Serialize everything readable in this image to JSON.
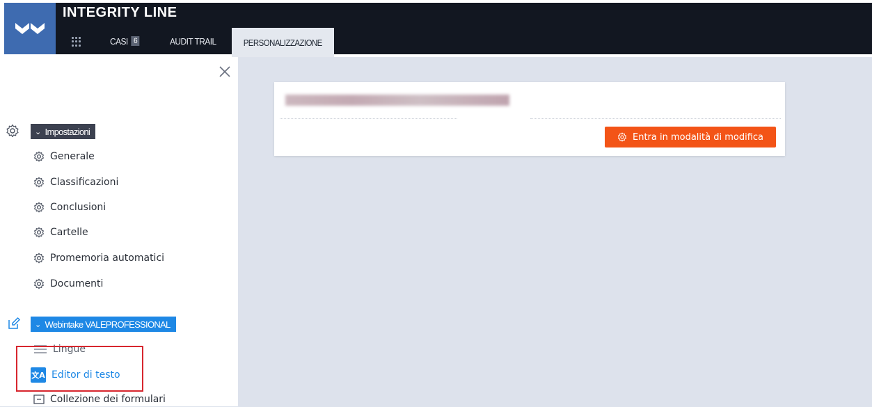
{
  "app": {
    "title": "INTEGRITY LINE"
  },
  "nav": {
    "tabs": [
      {
        "label": "CASI",
        "badge": "6"
      },
      {
        "label": "AUDIT TRAIL"
      },
      {
        "label": "PERSONALIZZAZIONE",
        "active": true
      }
    ]
  },
  "sidebar": {
    "settings_section": {
      "label": "Impostazioni",
      "items": [
        "Generale",
        "Classificazioni",
        "Conclusioni",
        "Cartelle",
        "Promemoria automatici",
        "Documenti"
      ]
    },
    "webintake_section": {
      "label": "Webintake VALEPROFESSIONAL",
      "items": [
        "Lingue",
        "Editor di testo",
        "Collezione dei formulari"
      ]
    }
  },
  "card": {
    "edit_button_label": "Entra in modalità di modifica"
  },
  "colors": {
    "topbar": "#121721",
    "logo": "#3e6bb0",
    "accent_blue": "#1e88e5",
    "section_dark": "#3c4150",
    "edit_button": "#f35417",
    "highlight": "#d7262e"
  }
}
